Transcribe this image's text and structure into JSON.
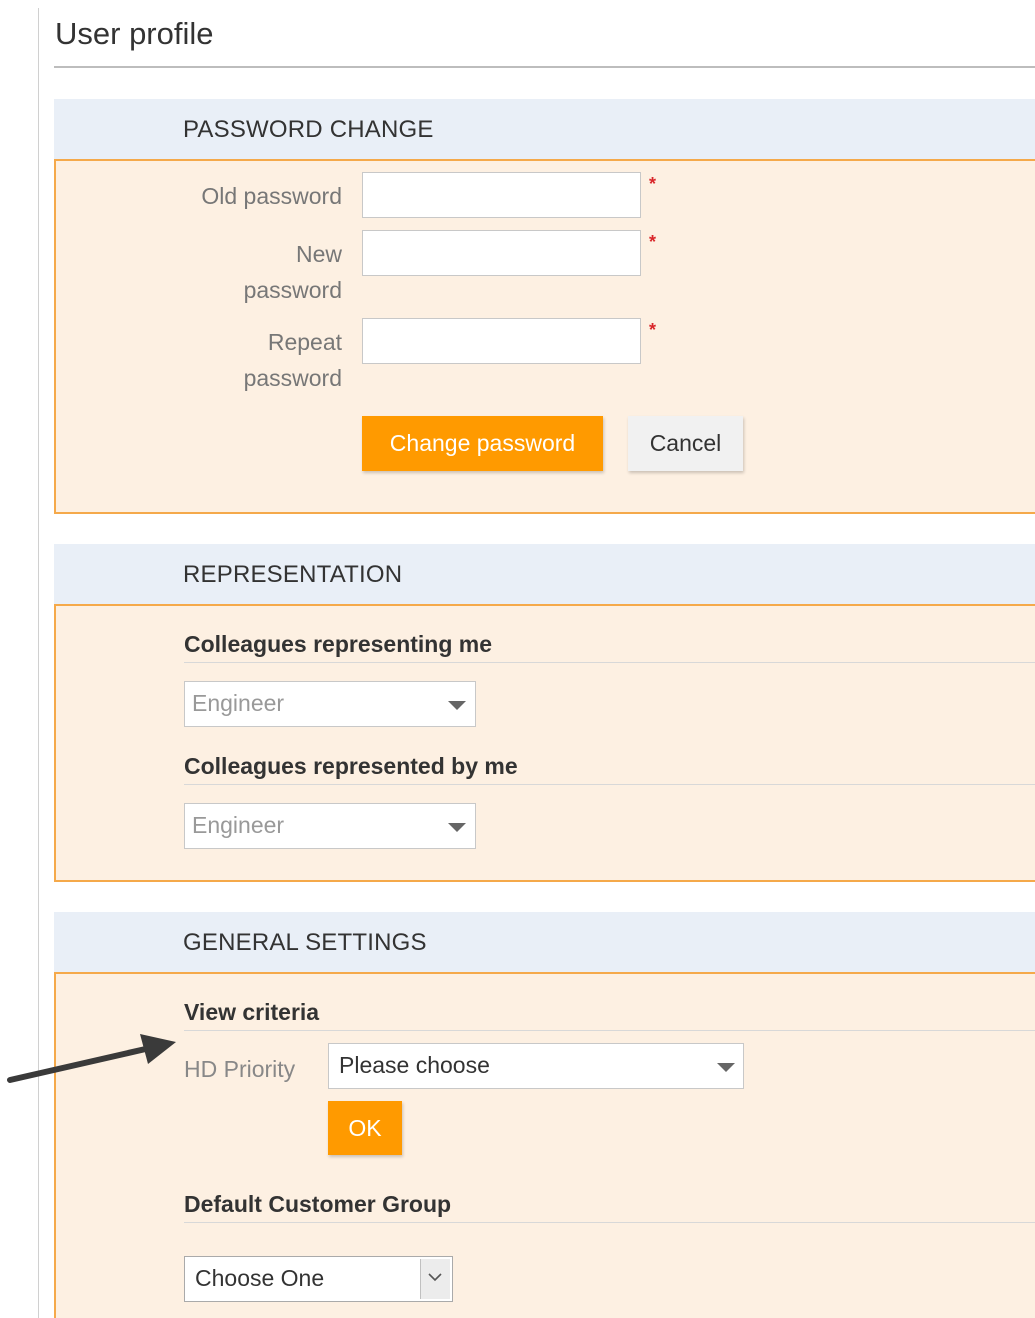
{
  "page": {
    "title": "User profile"
  },
  "password_change": {
    "section_title": "PASSWORD CHANGE",
    "old_password_label": "Old password",
    "new_password_label_line1": "New",
    "new_password_label_line2": "password",
    "repeat_password_label_line1": "Repeat",
    "repeat_password_label_line2": "password",
    "required_marker": "*",
    "old_password_value": "",
    "new_password_value": "",
    "repeat_password_value": "",
    "change_button": "Change password",
    "cancel_button": "Cancel"
  },
  "representation": {
    "section_title": "REPRESENTATION",
    "representing_me_heading": "Colleagues representing me",
    "representing_me_value": "Engineer",
    "represented_by_me_heading": "Colleagues represented by me",
    "represented_by_me_value": "Engineer"
  },
  "general_settings": {
    "section_title": "GENERAL SETTINGS",
    "view_criteria_heading": "View criteria",
    "hd_priority_label": "HD Priority",
    "hd_priority_value": "Please choose",
    "ok_button": "OK",
    "default_customer_group_heading": "Default Customer Group",
    "default_customer_group_value": "Choose One"
  },
  "colors": {
    "accent": "#ff9a00",
    "section_header_bg": "#e9eff7",
    "section_body_bg": "#fdf0e2",
    "section_border": "#f5a94a",
    "required": "#d9262a"
  },
  "icons": {
    "dropdown": "chevron-down-icon",
    "annotation": "arrow-icon"
  }
}
